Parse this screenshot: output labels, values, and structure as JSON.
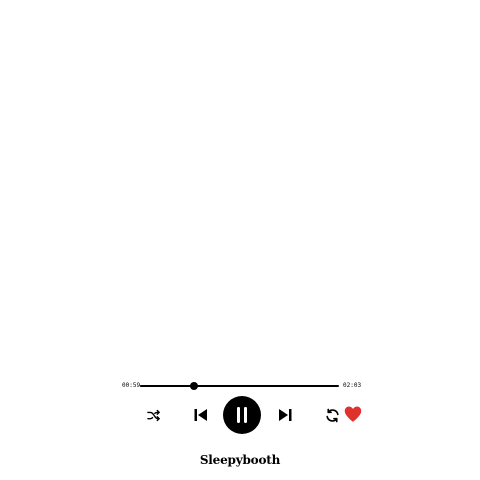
{
  "player": {
    "time_current": "00:59",
    "time_total": "02:03",
    "progress_fraction": 0.27,
    "title": "Sleepybooth",
    "is_playing": true,
    "liked": true
  },
  "icons": {
    "shuffle": "shuffle-icon",
    "previous": "skip-previous-icon",
    "play_pause": "pause-icon",
    "next": "skip-next-icon",
    "repeat": "repeat-icon",
    "favorite": "heart-icon"
  },
  "colors": {
    "foreground": "#000000",
    "background": "#ffffff",
    "heart": "#e0312f"
  }
}
